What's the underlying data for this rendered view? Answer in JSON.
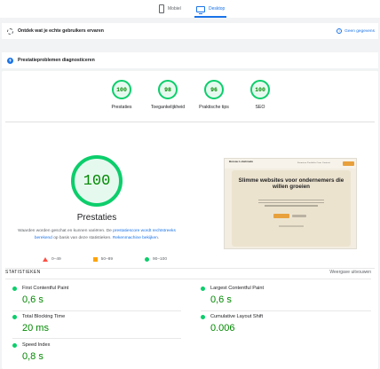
{
  "tabs": {
    "mobile": "Mobiel",
    "desktop": "Desktop"
  },
  "banners": {
    "real_users": "Ontdek wat je echte gebruikers ervaren",
    "no_data": "Geen gegevens",
    "diagnose": "Prestatieproblemen diagnosticeren"
  },
  "categories": [
    {
      "score": "100",
      "label": "Prestaties"
    },
    {
      "score": "98",
      "label": "Toegankelijkheid"
    },
    {
      "score": "96",
      "label": "Praktische tips"
    },
    {
      "score": "100",
      "label": "SEO"
    }
  ],
  "performance": {
    "score": "100",
    "title": "Prestaties",
    "desc_1": "Waarden worden geschat en kunnen variëren. De ",
    "link_1": "prestatiescore wordt rechtstreeks berekend",
    "desc_2": " op basis van deze statistieken. ",
    "link_2": "Rekenmachine bekijken",
    "desc_3": "."
  },
  "legend": {
    "bad": "0–49",
    "average": "50–89",
    "good": "90–100"
  },
  "preview": {
    "logo": "Bureau Lobelmade",
    "menu": "Diensten  Portfolio  Over  Contact",
    "headline": "Slimme websites voor ondernemers die willen groeien"
  },
  "metrics": {
    "header": "STATISTIEKEN",
    "toggle": "Weergave uitvouwen",
    "fcp": {
      "label": "First Contentful Paint",
      "value": "0,6 s"
    },
    "lcp": {
      "label": "Largest Contentful Paint",
      "value": "0,6 s"
    },
    "tbt": {
      "label": "Total Blocking Time",
      "value": "20 ms"
    },
    "cls": {
      "label": "Cumulative Layout Shift",
      "value": "0.006"
    },
    "si": {
      "label": "Speed Index",
      "value": "0,8 s"
    }
  },
  "colors": {
    "good": "#0cce6b",
    "average": "#ffa400",
    "bad": "#ff4e42",
    "accent": "#1a73e8"
  }
}
